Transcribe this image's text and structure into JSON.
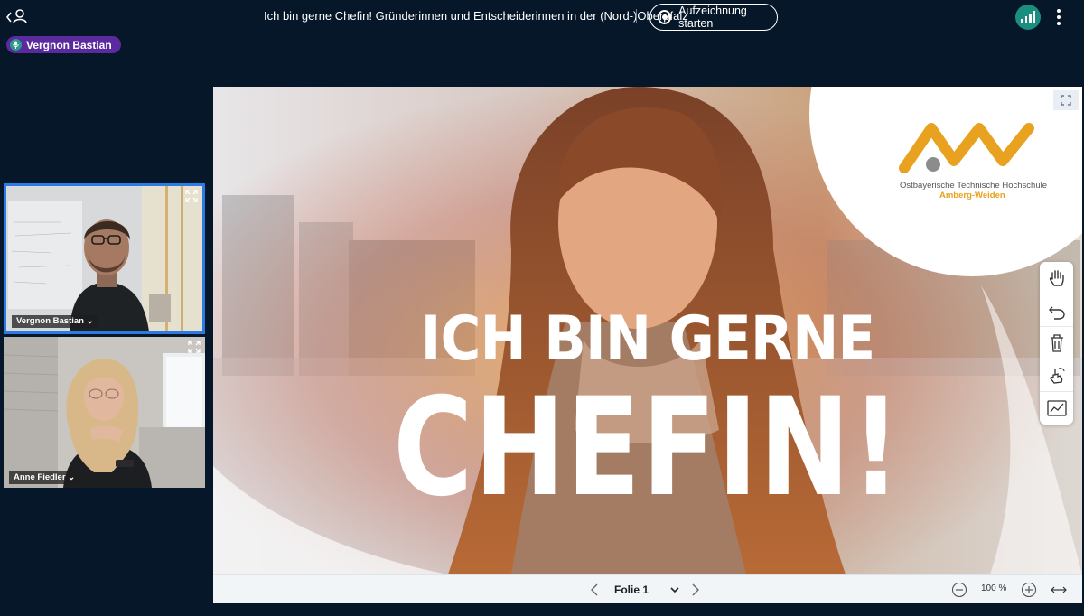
{
  "header": {
    "title": "Ich bin gerne Chefin! Gründerinnen und Entscheiderinnen in der (Nord-)Oberpfalz",
    "record_label": "Aufzeichnung starten",
    "icons": {
      "back": "chevron-left-icon",
      "user": "user-icon",
      "connection": "signal-bars-icon",
      "more": "more-vertical-icon"
    }
  },
  "speaker": {
    "name": "Vergnon Bastian",
    "icon": "microphone-icon"
  },
  "videos": [
    {
      "name": "Vergnon Bastian",
      "active": true
    },
    {
      "name": "Anne Fiedler",
      "active": false
    }
  ],
  "slide": {
    "headline_1": "ICH BIN GERNE",
    "headline_2": "CHEFIN!",
    "logo_line_1": "Ostbayerische Technische Hochschule",
    "logo_line_2": "Amberg-Weiden"
  },
  "tools": [
    "hand-icon",
    "undo-icon",
    "trash-icon",
    "pointer-hand-icon",
    "whiteboard-chart-icon"
  ],
  "slide_nav": {
    "current": "Folie 1",
    "zoom": "100 %"
  },
  "colors": {
    "background": "#06172a",
    "accent_purple": "#5b2a9e",
    "accent_teal": "#1b8f7f",
    "active_border": "#2c7be5",
    "logo_orange": "#e8a21f"
  }
}
